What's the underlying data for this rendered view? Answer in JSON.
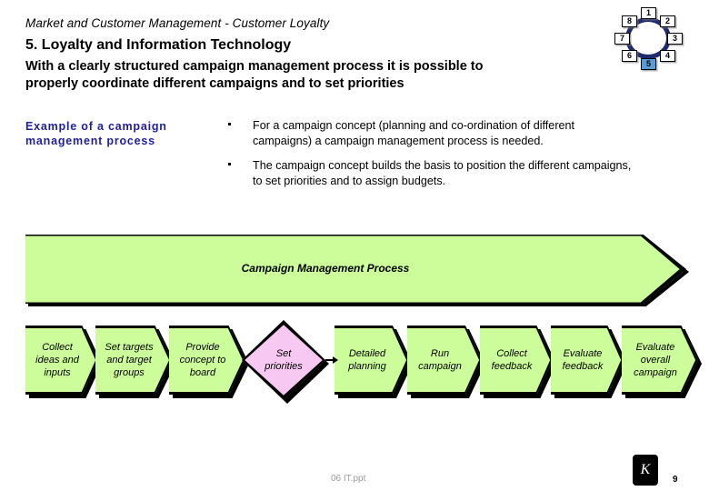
{
  "header": {
    "eyebrow": "Market and Customer Management - Customer Loyalty",
    "title": "5. Loyalty and Information Technology",
    "subtitle_line1": "With a clearly structured campaign management process it is possible to",
    "subtitle_line2": "properly coordinate different campaigns and to set priorities"
  },
  "chapter_wheel": {
    "icon": "circular-chapter-wheel-icon",
    "active_index": 5,
    "active_color": "#5b9bd5",
    "ring_color": "#202a6e",
    "nodes": [
      {
        "label": "1"
      },
      {
        "label": "2"
      },
      {
        "label": "3"
      },
      {
        "label": "4"
      },
      {
        "label": "5"
      },
      {
        "label": "6"
      },
      {
        "label": "7"
      },
      {
        "label": "8"
      }
    ]
  },
  "content": {
    "example_heading_line1": "Example of a campaign",
    "example_heading_line2": "management process",
    "example_heading_color": "#1f1f9c",
    "bullets": [
      {
        "line1": "For a campaign concept (planning and co-ordination of different",
        "line2": "campaigns) a campaign management process is needed."
      },
      {
        "line1": "The campaign concept builds the basis to position the different campaigns,",
        "line2": "to set priorities and to assign budgets."
      }
    ]
  },
  "banner": {
    "label": "Campaign Management Process",
    "fill_color": "#cdfd9a"
  },
  "process": {
    "step_fill_color": "#cdfd9a",
    "decision_fill_color": "#f7c9f2",
    "steps": [
      {
        "shape": "chevron",
        "line1": "Collect",
        "line2": "ideas and",
        "line3": "inputs"
      },
      {
        "shape": "chevron",
        "line1": "Set targets",
        "line2": "and target",
        "line3": "groups"
      },
      {
        "shape": "chevron",
        "line1": "Provide",
        "line2": "concept to",
        "line3": "board"
      },
      {
        "shape": "diamond",
        "line1": "Set",
        "line2": "priorities",
        "line3": ""
      },
      {
        "shape": "chevron",
        "line1": "Detailed",
        "line2": "planning",
        "line3": ""
      },
      {
        "shape": "chevron",
        "line1": "Run",
        "line2": "campaign",
        "line3": ""
      },
      {
        "shape": "chevron",
        "line1": "Collect",
        "line2": "feedback",
        "line3": ""
      },
      {
        "shape": "chevron",
        "line1": "Evaluate",
        "line2": "feedback",
        "line3": ""
      },
      {
        "shape": "chevron",
        "line1": "Evaluate",
        "line2": "overall",
        "line3": "campaign"
      }
    ]
  },
  "footer": {
    "filename": "06 IT.ppt",
    "logo_glyph": "K",
    "page_number": "9"
  }
}
